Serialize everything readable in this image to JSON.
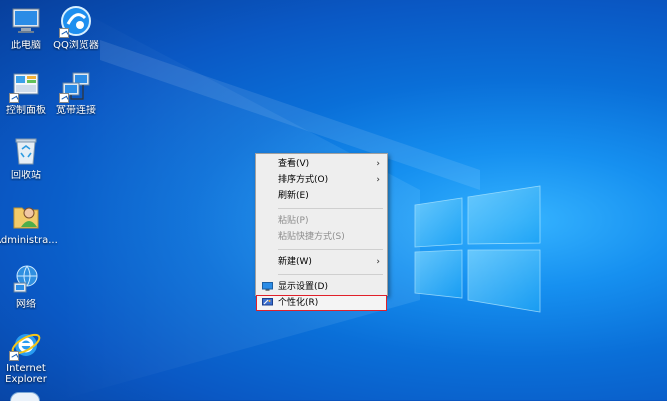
{
  "desktop_icons": [
    {
      "id": "this-pc",
      "label": "此电脑",
      "icon": "computer-icon",
      "shortcut": false
    },
    {
      "id": "qq-browser",
      "label": "QQ浏览器",
      "icon": "qq-browser-icon",
      "shortcut": true
    },
    {
      "id": "control-panel",
      "label": "控制面板",
      "icon": "control-panel-icon",
      "shortcut": true
    },
    {
      "id": "broadband",
      "label": "宽带连接",
      "icon": "broadband-connection-icon",
      "shortcut": true
    },
    {
      "id": "recycle-bin",
      "label": "回收站",
      "icon": "recycle-bin-icon",
      "shortcut": false
    },
    {
      "id": "administrator",
      "label": "Administra...",
      "icon": "user-folder-icon",
      "shortcut": false
    },
    {
      "id": "network",
      "label": "网络",
      "icon": "network-icon",
      "shortcut": false
    },
    {
      "id": "ie",
      "label": "Internet Explorer",
      "icon": "internet-explorer-icon",
      "shortcut": true
    }
  ],
  "context_menu": {
    "view": "查看(V)",
    "sort_by": "排序方式(O)",
    "refresh": "刷新(E)",
    "paste": "粘贴(P)",
    "paste_shortcut": "粘贴快捷方式(S)",
    "new": "新建(W)",
    "display_settings": "显示设置(D)",
    "personalize": "个性化(R)",
    "submenu_arrow": "›"
  },
  "colors": {
    "highlight_box": "#e0202a",
    "wallpaper_blue": "#0a6fd8"
  }
}
